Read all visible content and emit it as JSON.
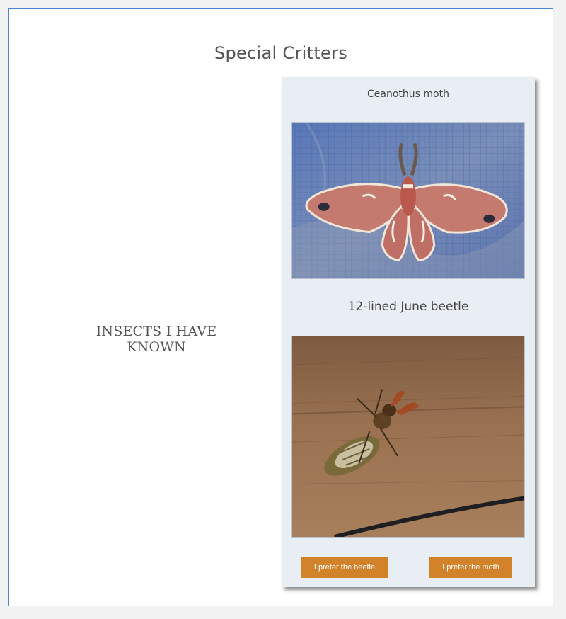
{
  "page": {
    "title": "Special Critters",
    "side_heading": "INSECTS I HAVE KNOWN"
  },
  "card": {
    "items": [
      {
        "caption": "Ceanothus moth",
        "image": "ceanothus-moth-photo"
      },
      {
        "caption": "12-lined June beetle",
        "image": "june-beetle-photo"
      }
    ],
    "buttons": {
      "beetle_label": "I prefer the beetle",
      "moth_label": "I prefer the moth"
    }
  },
  "colors": {
    "frame_border": "#4a86d4",
    "card_background": "#e9eef4",
    "button_background": "#d2832a",
    "button_text": "#ffffff",
    "text": "#555555"
  }
}
